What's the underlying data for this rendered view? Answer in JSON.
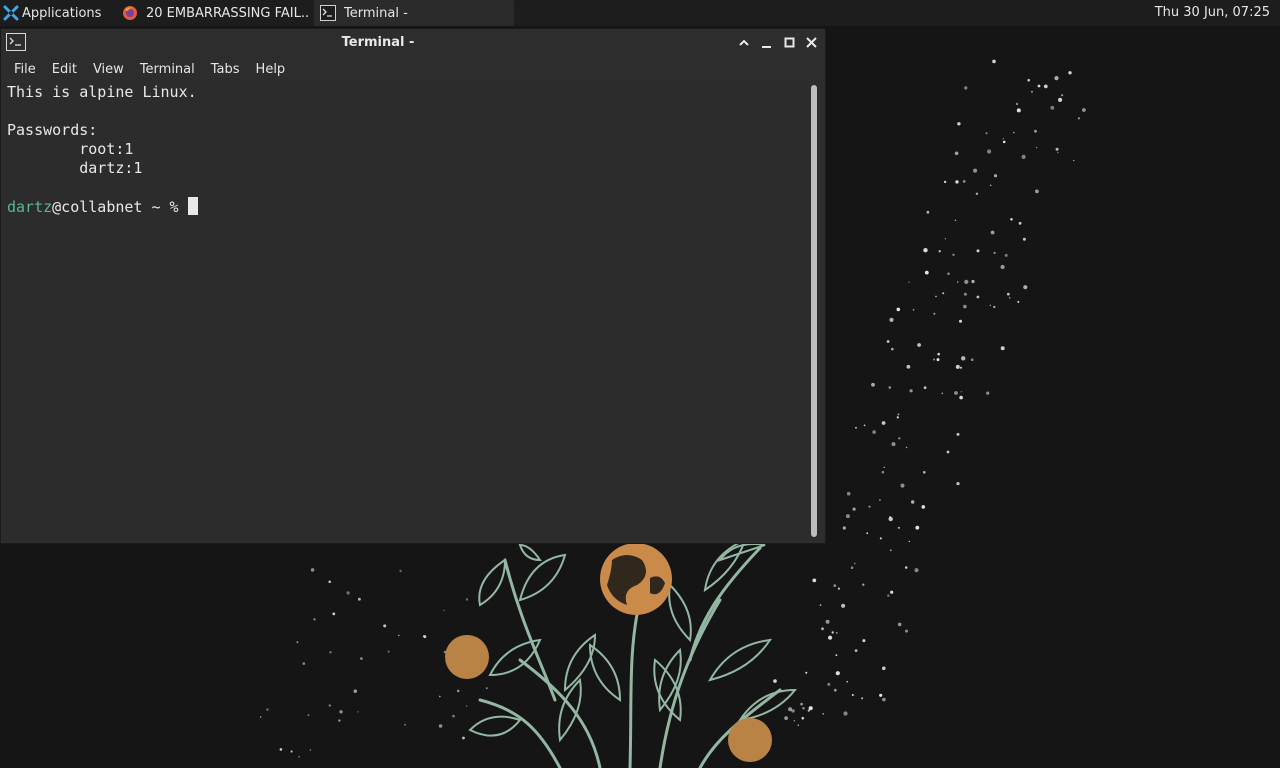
{
  "panel": {
    "applications_label": "Applications",
    "tasks": [
      {
        "label": "20 EMBARRASSING FAIL...",
        "icon": "firefox-icon"
      },
      {
        "label": "Terminal -",
        "icon": "terminal-icon"
      }
    ],
    "clock": "Thu 30 Jun, 07:25"
  },
  "window": {
    "title": "Terminal -",
    "menu": [
      "File",
      "Edit",
      "View",
      "Terminal",
      "Tabs",
      "Help"
    ],
    "lines": {
      "line1": "This is alpine Linux.",
      "line2": "Passwords:",
      "line3": "        root:1",
      "line4": "        dartz:1"
    },
    "prompt": {
      "user": "dartz",
      "host": "@collabnet ~ % "
    }
  },
  "colors": {
    "prompt_user": "#5bb88c",
    "panel_bg": "#1d1d1d",
    "terminal_bg": "#2c2c2c",
    "wallpaper_bg": "#141414",
    "leaf_green": "#93b7a3",
    "orb_orange": "#c98a4a"
  }
}
